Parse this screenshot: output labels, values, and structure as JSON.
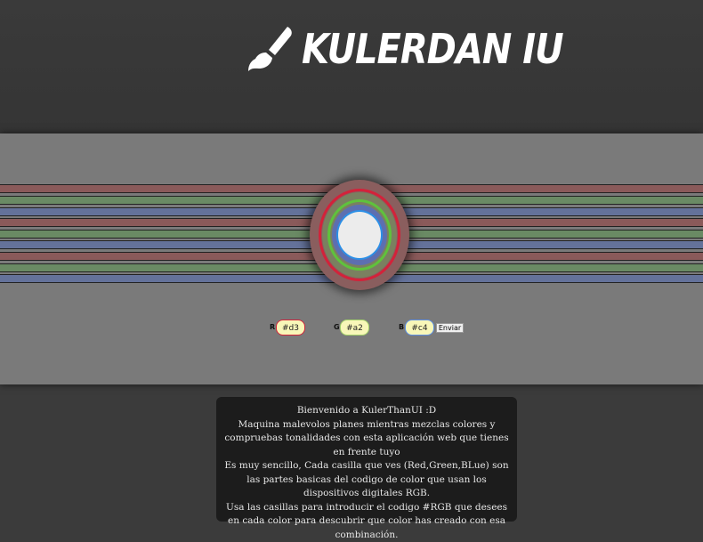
{
  "header": {
    "logo_text": "KULERDAN IU",
    "logo_icon": "paintbrush-icon"
  },
  "stripes": {
    "colors": [
      "#8a5a5a",
      "#6a8a64",
      "#64729a",
      "#8a5a5a",
      "#6a8a64",
      "#64729a",
      "#8a5a5a",
      "#6a8a64",
      "#64729a"
    ]
  },
  "preview": {
    "ring_colors": [
      "#8a5e5e",
      "#d3223a",
      "#7a8060",
      "#5fc23c",
      "#5d6fb0",
      "#2c8fe6",
      "#ececec"
    ]
  },
  "controls": {
    "r_label": "R",
    "r_value": "#d3",
    "g_label": "G",
    "g_value": "#a2",
    "b_label": "B",
    "b_value": "#c4",
    "submit_label": "Enviar"
  },
  "info": {
    "lines": [
      "Bienvenido a KulerThanUI :D",
      "Maquina malevolos planes mientras mezclas colores y compruebas tonalidades con esta aplicación web que tienes en frente tuyo",
      "Es muy sencillo, Cada casilla que ves (Red,Green,BLue) son las partes basicas del codigo de color que usan los dispositivos digitales RGB.",
      "Usa las casillas para introducir el codigo #RGB que desees en cada color para descubrir que color has creado con esa combinación."
    ]
  }
}
